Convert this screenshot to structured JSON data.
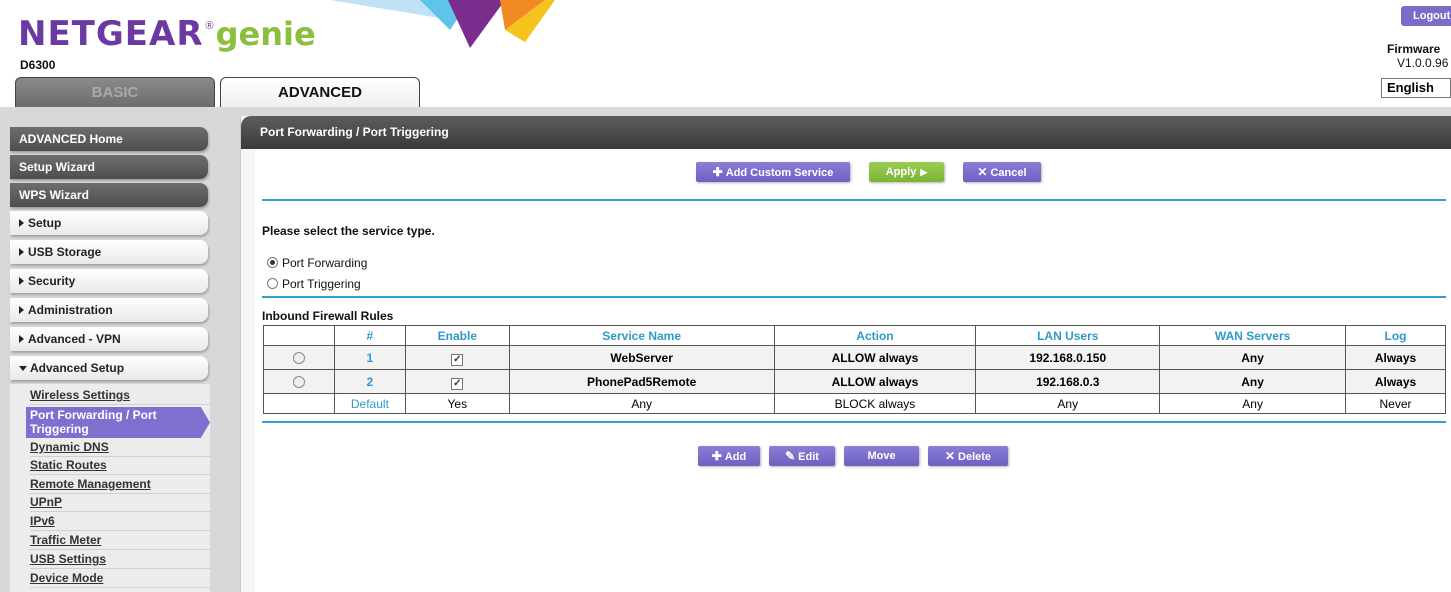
{
  "brand": {
    "netgear": "NETGEAR",
    "reg": "®",
    "genie": "genie",
    "model": "D6300"
  },
  "tabs": {
    "basic": "BASIC",
    "advanced": "ADVANCED"
  },
  "topright": {
    "logout": "Logout",
    "firmware_label": "Firmware",
    "firmware_version": "V1.0.0.96",
    "language": "English"
  },
  "sidebar": {
    "top_items": [
      "ADVANCED Home",
      "Setup Wizard",
      "WPS Wizard"
    ],
    "sections": [
      "Setup",
      "USB Storage",
      "Security",
      "Administration",
      "Advanced - VPN",
      "Advanced Setup"
    ],
    "sub_items": [
      "Wireless Settings",
      "Port Forwarding / Port Triggering",
      "Dynamic DNS",
      "Static Routes",
      "Remote Management",
      "UPnP",
      "IPv6",
      "Traffic Meter",
      "USB Settings",
      "Device Mode"
    ]
  },
  "panel": {
    "title": "Port Forwarding / Port Triggering",
    "add_custom_service": "Add Custom Service",
    "apply": "Apply",
    "cancel": "Cancel",
    "service_prompt": "Please select the service type.",
    "radio_forwarding": "Port Forwarding",
    "radio_triggering": "Port Triggering",
    "rules_title": "Inbound Firewall Rules"
  },
  "table": {
    "headers": [
      "#",
      "Enable",
      "Service Name",
      "Action",
      "LAN Users",
      "WAN Servers",
      "Log"
    ],
    "rows": [
      {
        "num": "1",
        "service": "WebServer",
        "action": "ALLOW always",
        "lan": "192.168.0.150",
        "wan": "Any",
        "log": "Always"
      },
      {
        "num": "2",
        "service": "PhonePad5Remote",
        "action": "ALLOW always",
        "lan": "192.168.0.3",
        "wan": "Any",
        "log": "Always"
      }
    ],
    "default_row": {
      "num": "Default",
      "enable": "Yes",
      "service": "Any",
      "action": "BLOCK always",
      "lan": "Any",
      "wan": "Any",
      "log": "Never"
    }
  },
  "actions": {
    "add": "Add",
    "edit": "Edit",
    "move": "Move",
    "delete": "Delete"
  },
  "colors": {
    "accent_purple": "#7d70cf",
    "accent_green": "#8cbf3f",
    "table_header": "#2f9ac8",
    "rule_line": "#2fa3cf"
  }
}
